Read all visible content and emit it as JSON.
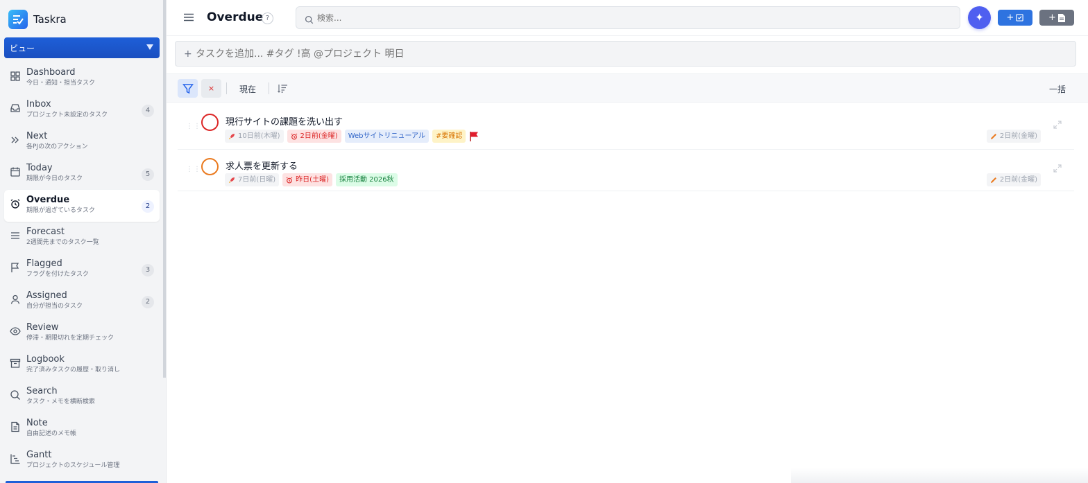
{
  "app": {
    "name": "Taskra"
  },
  "sidebar": {
    "view_select": "ビュー",
    "items": [
      {
        "label": "Dashboard",
        "sub": "今日・通知・担当タスク",
        "count": null,
        "icon": "grid-icon"
      },
      {
        "label": "Inbox",
        "sub": "プロジェクト未設定のタスク",
        "count": "4",
        "icon": "inbox-icon"
      },
      {
        "label": "Next",
        "sub": "各PJの次のアクション",
        "count": null,
        "icon": "chevrons-right-icon"
      },
      {
        "label": "Today",
        "sub": "期限が今日のタスク",
        "count": "5",
        "icon": "calendar-icon"
      },
      {
        "label": "Overdue",
        "sub": "期限が過ぎているタスク",
        "count": "2",
        "icon": "alarm-clock-icon"
      },
      {
        "label": "Forecast",
        "sub": "2週間先までのタスク一覧",
        "count": null,
        "icon": "lines-icon"
      },
      {
        "label": "Flagged",
        "sub": "フラグを付けたタスク",
        "count": "3",
        "icon": "flag-icon"
      },
      {
        "label": "Assigned",
        "sub": "自分が担当のタスク",
        "count": "2",
        "icon": "user-icon"
      },
      {
        "label": "Review",
        "sub": "停滞・期限切れを定期チェック",
        "count": null,
        "icon": "eye-icon"
      },
      {
        "label": "Logbook",
        "sub": "完了済みタスクの履歴・取り消し",
        "count": null,
        "icon": "archive-icon"
      },
      {
        "label": "Search",
        "sub": "タスク・メモを横断検索",
        "count": null,
        "icon": "search-icon"
      },
      {
        "label": "Note",
        "sub": "自由記述のメモ帳",
        "count": null,
        "icon": "document-icon"
      },
      {
        "label": "Gantt",
        "sub": "プロジェクトのスケジュール管理",
        "count": null,
        "icon": "gantt-icon"
      }
    ]
  },
  "header": {
    "title": "Overdue",
    "help": "?",
    "search_placeholder": "検索...",
    "ai_label": "✦",
    "add_task_label": "+",
    "add_note_label": "+"
  },
  "quick_add": {
    "plus": "+",
    "placeholder": "タスクを追加... #タグ !高 @プロジェクト 明日"
  },
  "toolbar": {
    "clear": "×",
    "now": "現在",
    "bulk": "一括"
  },
  "tasks": [
    {
      "title": "現行サイトの課題を洗い出す",
      "check_color": "red",
      "start": "10日前(木曜)",
      "due": "2日前(金曜)",
      "project": "Webサイトリニューアル",
      "tag": "#要確認",
      "flagged": true,
      "updated": "2日前(金曜)"
    },
    {
      "title": "求人票を更新する",
      "check_color": "orange",
      "start": "7日前(日曜)",
      "due": "昨日(土曜)",
      "project": "採用活動 2026秋",
      "updated": "2日前(金曜)"
    }
  ],
  "colors": {
    "accent": "#2e73e0",
    "overdue_red": "#dc2626",
    "ai_purple": "#4f5ff0"
  }
}
